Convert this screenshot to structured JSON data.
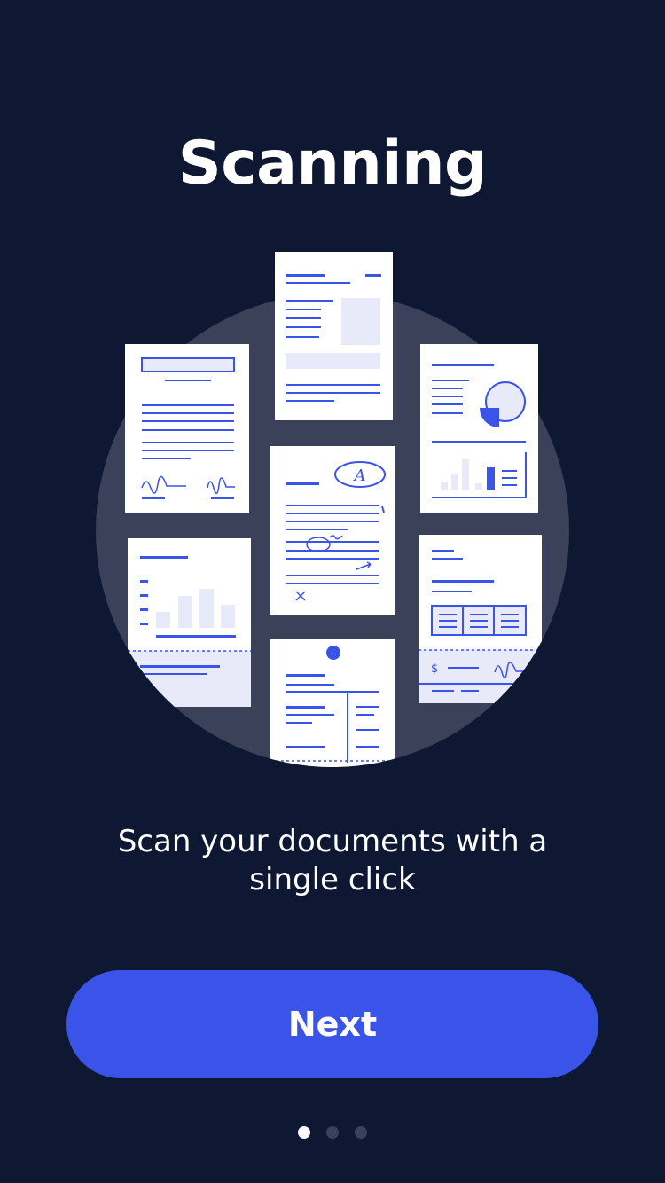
{
  "onboarding": {
    "title": "Scanning",
    "subtitle": "Scan your documents with a single click",
    "next_label": "Next",
    "current_page": 1,
    "total_pages": 3
  },
  "illustration": {
    "icon": "document-stack-illustration",
    "amount_symbol": "$",
    "grade_letter": "A"
  },
  "colors": {
    "background": "#0f1833",
    "accent": "#3a53e8",
    "circle": "#3a4158",
    "paper": "#ffffff",
    "paper_tint": "#e8eaf9"
  }
}
